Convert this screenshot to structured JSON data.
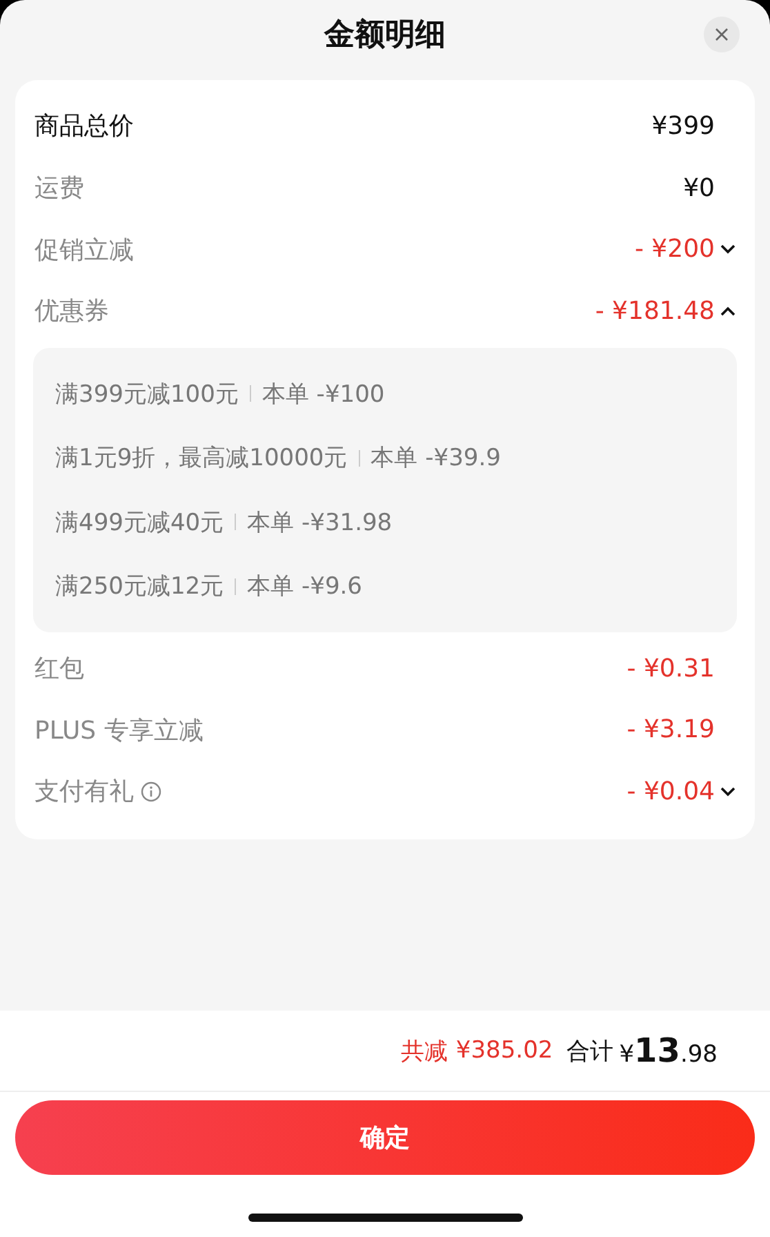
{
  "title": "金额明细",
  "rows": [
    {
      "label": "商品总价",
      "amount": "¥399",
      "kind": "total"
    },
    {
      "label": "运费",
      "amount": "¥0",
      "kind": "plain"
    },
    {
      "label": "促销立减",
      "amount": "- ¥200",
      "kind": "discount",
      "expanded": false
    },
    {
      "label": "优惠券",
      "amount": "- ¥181.48",
      "kind": "discount",
      "expanded": true,
      "details": [
        {
          "condition": "满399元减100元",
          "saving": "本单 -¥100"
        },
        {
          "condition": "满1元9折，最高减10000元",
          "saving": "本单 -¥39.9"
        },
        {
          "condition": "满499元减40元",
          "saving": "本单 -¥31.98"
        },
        {
          "condition": "满250元减12元",
          "saving": "本单 -¥9.6"
        }
      ]
    },
    {
      "label": "红包",
      "amount": "- ¥0.31",
      "kind": "discount"
    },
    {
      "label": "PLUS 专享立减",
      "amount": "- ¥3.19",
      "kind": "discount"
    },
    {
      "label": "支付有礼",
      "amount": "- ¥0.04",
      "kind": "discount",
      "info": true,
      "expanded": false
    }
  ],
  "footer": {
    "saved_label": "共减",
    "saved_amount": "¥385.02",
    "total_label": "合计",
    "total_currency": "¥",
    "total_integer": "13",
    "total_decimal": ".98"
  },
  "confirm": "确定"
}
